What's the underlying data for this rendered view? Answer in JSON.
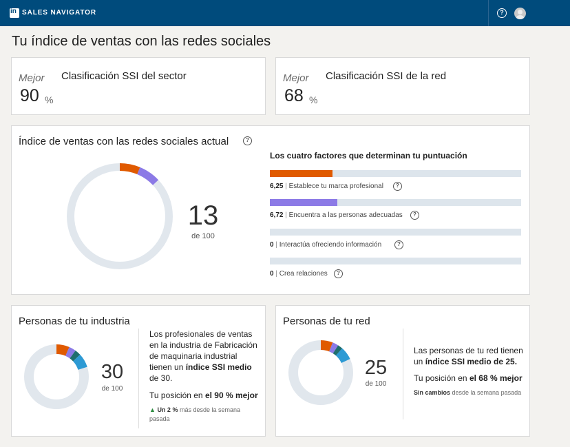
{
  "topbar": {
    "logo_text": "in",
    "brand": "SALES NAVIGATOR",
    "help_icon": "help-circle-icon",
    "avatar_icon": "user-avatar-icon"
  },
  "page_title": "Tu índice de ventas con las redes sociales",
  "rank_cards": [
    {
      "mejor": "Mejor",
      "title": "Clasificación SSI del sector",
      "value": "90",
      "unit": "%"
    },
    {
      "mejor": "Mejor",
      "title": "Clasificación SSI de la red",
      "value": "68",
      "unit": "%"
    }
  ],
  "ssi_card": {
    "title": "Índice de ventas con las redes sociales actual",
    "score": "13",
    "out_of": "de 100",
    "factors_title": "Los cuatro factores que determinan tu puntuación",
    "factors": [
      {
        "value": "6,25",
        "label": "Establece tu marca profesional",
        "score": 6.25,
        "max": 25,
        "color": "#e05a00"
      },
      {
        "value": "6,72",
        "label": "Encuentra a las personas adecuadas",
        "score": 6.72,
        "max": 25,
        "color": "#8c7ae6"
      },
      {
        "value": "0",
        "label": "Interactúa ofreciendo información",
        "score": 0,
        "max": 25,
        "color": "#2d9ad4"
      },
      {
        "value": "0",
        "label": "Crea relaciones",
        "score": 0,
        "max": 25,
        "color": "#1f6e6e"
      }
    ]
  },
  "industry_card": {
    "title": "Personas de tu industria",
    "score": "30",
    "out_of": "de 100",
    "desc_pre": "Los profesionales de ventas en la industria de Fabricación de maquinaria industrial tienen un ",
    "desc_bold": "índice SSI medio",
    "desc_post": " de 30.",
    "position_pre": "Tu posición en ",
    "position_bold": "el 90 % mejor",
    "change_icon": "arrow-up-icon",
    "change_bold": "Un 2 %",
    "change_rest": " más desde la semana pasada",
    "segments": [
      6.5,
      3.5,
      3.0,
      7.0
    ]
  },
  "network_card": {
    "title": "Personas de tu red",
    "score": "25",
    "out_of": "de 100",
    "desc_pre": "Las personas de tu red tienen un ",
    "desc_bold": "índice SSI medio de 25.",
    "position_pre": "Tu posición en ",
    "position_bold": "el 68 % mejor",
    "change_bold": "Sin cambios",
    "change_rest": " desde la semana pasada",
    "segments": [
      6.0,
      3.0,
      2.5,
      6.5
    ]
  },
  "colors": {
    "factor1": "#e05a00",
    "factor2": "#8c7ae6",
    "factor3": "#2d9ad4",
    "factor4": "#1f6e6e",
    "ring_bg": "#e1e7ed",
    "topbar": "#004b7c"
  }
}
